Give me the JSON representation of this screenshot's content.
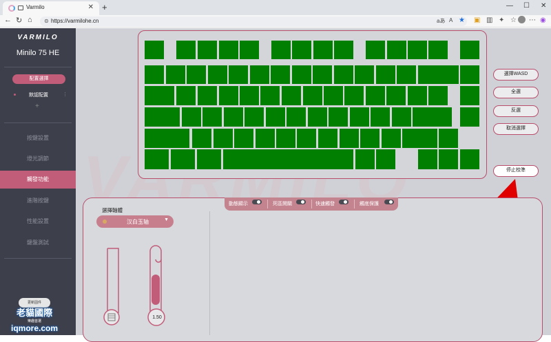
{
  "browser": {
    "tab_title": "Varmilo",
    "tab_close": "✕",
    "new_tab": "+",
    "window_controls": [
      "—",
      "☐",
      "✕"
    ],
    "url": "https://varmilohe.cn",
    "read_aloud": "aあ",
    "text_size": "A",
    "favorite": "★"
  },
  "sidebar": {
    "logo": "VARMILO",
    "model": "Minilo 75 HE",
    "profile_select": "配置選擇",
    "profile_default": "默認配置",
    "profile_more": "⋮",
    "profile_add": "+",
    "nav": [
      "按鍵設置",
      "燈光調節",
      "觸發功能",
      "進階按鍵",
      "性能設置",
      "鍵盤測試"
    ],
    "active_nav_index": 2,
    "bottom_button": "更新固件"
  },
  "watermark": {
    "line1": "老貓國際",
    "sub": "樂趣首選",
    "line2": "iqmore.com"
  },
  "background_text": "VARMILO",
  "keyboard": {
    "key_color": "#007f00",
    "row_count": 6
  },
  "actions": {
    "select_wasd": "選擇WASD",
    "select_all": "全選",
    "invert": "反選",
    "cancel": "取消選擇",
    "stop_calibration": "停止校準"
  },
  "toggles": [
    "動態顯示",
    "死區開關",
    "快速觸發",
    "觸底保護"
  ],
  "switch": {
    "label": "選擇軸體",
    "selected": "汉白玉轴"
  },
  "gauge": {
    "value_label": "1.50"
  },
  "colors": {
    "accent": "#c15c79",
    "sidebar_bg": "#3d3f4b",
    "key_green": "#007f00",
    "arrow_red": "#e00000"
  }
}
